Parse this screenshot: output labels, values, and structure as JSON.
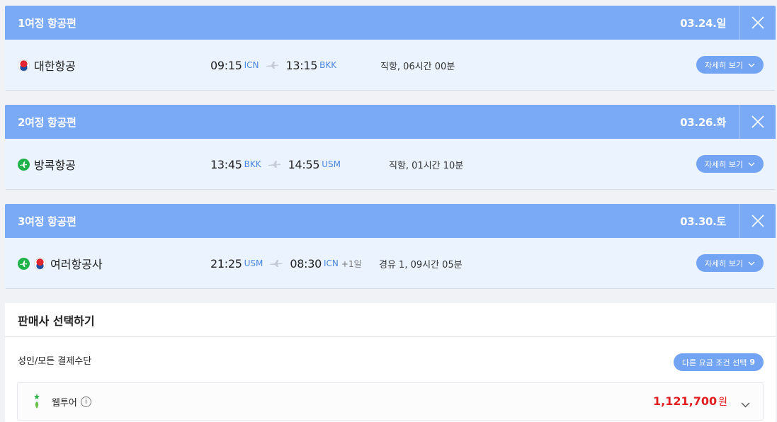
{
  "legs": [
    {
      "title": "1여정 항공편",
      "date": "03.24.일",
      "airline": "대한항공",
      "logos": [
        "ke"
      ],
      "dep_time": "09:15",
      "dep_code": "ICN",
      "arr_time": "13:15",
      "arr_code": "BKK",
      "extra": "",
      "duration": "직항, 06시간 00분"
    },
    {
      "title": "2여정 항공편",
      "date": "03.26.화",
      "airline": "방콕항공",
      "logos": [
        "pg"
      ],
      "dep_time": "13:45",
      "dep_code": "BKK",
      "arr_time": "14:55",
      "arr_code": "USM",
      "extra": "",
      "duration": "직항, 01시간 10분"
    },
    {
      "title": "3여정 항공편",
      "date": "03.30.토",
      "airline": "여러항공사",
      "logos": [
        "pg",
        "ke"
      ],
      "dep_time": "21:25",
      "dep_code": "USM",
      "arr_time": "08:30",
      "arr_code": "ICN",
      "extra": "+1일",
      "duration": "경유 1, 09시간 05분"
    }
  ],
  "detail_label": "자세히 보기",
  "seller": {
    "title": "판매사 선택하기",
    "fare_type": "성인/모든 결제수단",
    "condition_label": "다른 요금 조건 선택",
    "condition_count": "9",
    "vendor_name": "웹투어",
    "price": "1,121,700",
    "price_unit": "원"
  },
  "colors": {
    "header_blue": "#7aa9f5",
    "body_blue": "#eaf3fe",
    "button_blue": "#73a4f3",
    "price_red": "#e02020"
  }
}
